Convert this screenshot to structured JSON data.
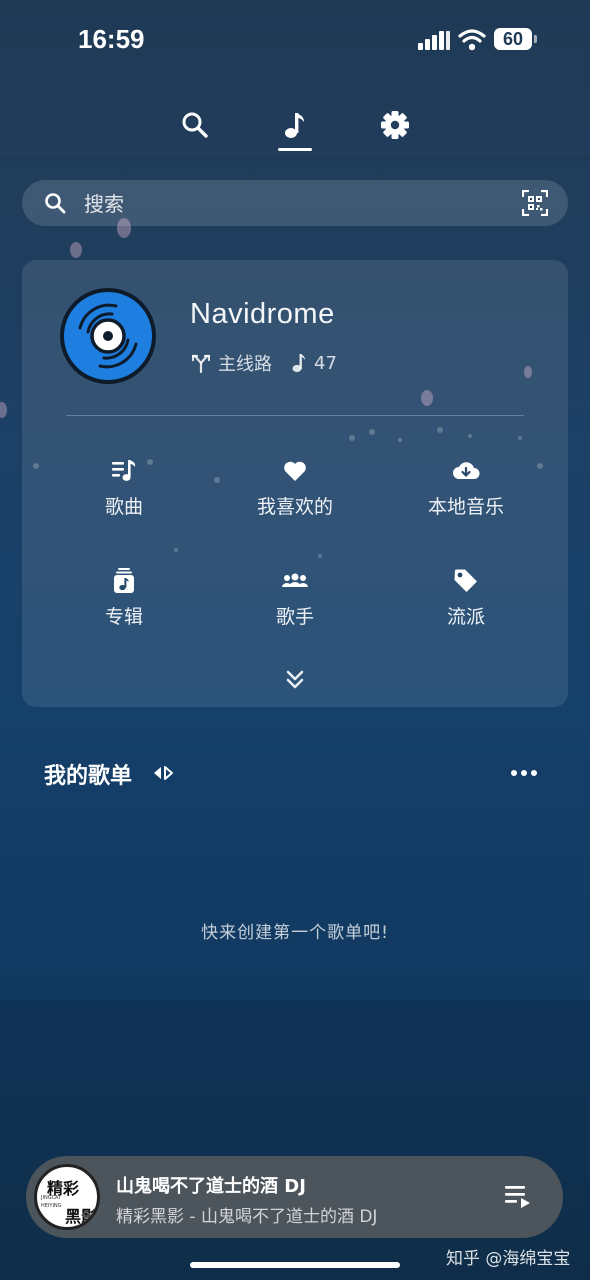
{
  "status_bar": {
    "time": "16:59",
    "battery": "60"
  },
  "nav": {
    "tabs": [
      {
        "icon": "search-icon"
      },
      {
        "icon": "music-note-icon",
        "active": true
      },
      {
        "icon": "gear-icon"
      }
    ]
  },
  "search": {
    "placeholder": "搜索"
  },
  "server": {
    "name": "Navidrome",
    "route_label": "主线路",
    "song_count": "47"
  },
  "grid": [
    {
      "label": "歌曲",
      "icon": "song-list-icon"
    },
    {
      "label": "我喜欢的",
      "icon": "heart-icon"
    },
    {
      "label": "本地音乐",
      "icon": "cloud-download-icon"
    },
    {
      "label": "专辑",
      "icon": "album-icon"
    },
    {
      "label": "歌手",
      "icon": "artists-icon"
    },
    {
      "label": "流派",
      "icon": "tag-icon"
    }
  ],
  "playlists": {
    "title": "我的歌单",
    "empty_message": "快来创建第一个歌单吧!"
  },
  "player": {
    "title": "山鬼喝不了道士的酒 DJ",
    "subtitle": "精彩黑影 - 山鬼喝不了道士的酒 DJ",
    "cover_text_1": "精彩",
    "cover_text_2": "黑影",
    "cover_small_1": "JINGCAI",
    "cover_small_2": "HEIYING"
  },
  "watermark": "知乎 @海绵宝宝",
  "colors": {
    "accent": "#1e7fe0",
    "background": "#1a3d62"
  }
}
